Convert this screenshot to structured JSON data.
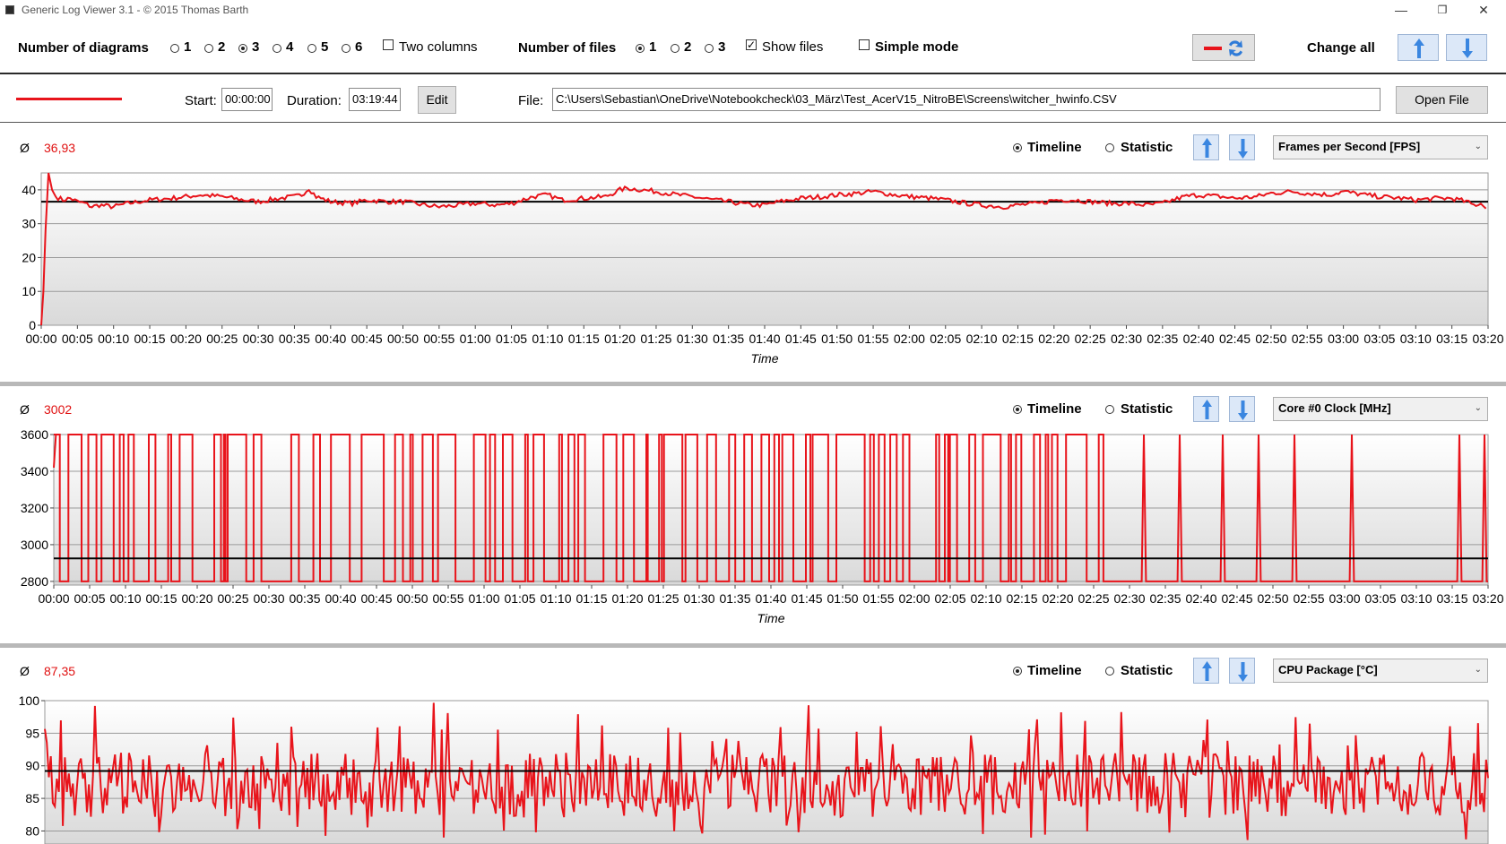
{
  "window": {
    "title": "Generic Log Viewer 3.1 - © 2015 Thomas Barth",
    "minimize": "—",
    "restore": "❐",
    "close": "✕"
  },
  "toolbar": {
    "num_diagrams_label": "Number of diagrams",
    "diagram_options": [
      "1",
      "2",
      "3",
      "4",
      "5",
      "6"
    ],
    "diagram_selected": "3",
    "two_columns_label": "Two columns",
    "num_files_label": "Number of files",
    "file_options": [
      "1",
      "2",
      "3"
    ],
    "file_selected": "1",
    "show_files_label": "Show files",
    "show_files_checked": true,
    "simple_mode_label": "Simple mode",
    "simple_mode_checked": false,
    "change_all_label": "Change all",
    "swap_button_icon": "swap-color-icon",
    "arrow_up_icon": "arrow-up-icon",
    "arrow_down_icon": "arrow-down-icon"
  },
  "file_row": {
    "series_color": "#e8141b",
    "start_label": "Start:",
    "start_value": "00:00:00",
    "duration_label": "Duration:",
    "duration_value": "03:19:44",
    "edit_label": "Edit",
    "file_label": "File:",
    "file_path": "C:\\Users\\Sebastian\\OneDrive\\Notebookcheck\\03_März\\Test_AcerV15_NitroBE\\Screens\\witcher_hwinfo.CSV",
    "open_file_label": "Open File"
  },
  "panels": [
    {
      "avg_symbol": "Ø",
      "avg_value": "36,93",
      "timeline_label": "Timeline",
      "statistic_label": "Statistic",
      "mode": "Timeline",
      "sensor": "Frames per Second [FPS]"
    },
    {
      "avg_symbol": "Ø",
      "avg_value": "3002",
      "timeline_label": "Timeline",
      "statistic_label": "Statistic",
      "mode": "Timeline",
      "sensor": "Core #0 Clock [MHz]"
    },
    {
      "avg_symbol": "Ø",
      "avg_value": "87,35",
      "timeline_label": "Timeline",
      "statistic_label": "Statistic",
      "mode": "Timeline",
      "sensor": "CPU Package [°C]"
    }
  ],
  "chart_data": [
    {
      "type": "line",
      "xlabel": "Time",
      "ylabel": "",
      "ylim": [
        0,
        45
      ],
      "yticks": [
        0,
        10,
        20,
        30,
        40
      ],
      "x_ticks": [
        "00:00",
        "00:05",
        "00:10",
        "00:15",
        "00:20",
        "00:25",
        "00:30",
        "00:35",
        "00:40",
        "00:45",
        "00:50",
        "00:55",
        "01:00",
        "01:05",
        "01:10",
        "01:15",
        "01:20",
        "01:25",
        "01:30",
        "01:35",
        "01:40",
        "01:45",
        "01:50",
        "01:55",
        "02:00",
        "02:05",
        "02:10",
        "02:15",
        "02:20",
        "02:25",
        "02:30",
        "02:35",
        "02:40",
        "02:45",
        "02:50",
        "02:55",
        "03:00",
        "03:05",
        "03:10",
        "03:15",
        "03:20"
      ],
      "xlim_minutes": [
        0,
        200
      ],
      "average_line": 36.5,
      "grid": "horizontal",
      "series": [
        {
          "color": "#e8141b",
          "x_minutes": [
            0,
            0.3,
            0.6,
            1,
            1.5,
            2,
            3,
            4,
            5,
            6,
            7,
            8,
            10,
            12,
            15,
            18,
            20,
            22,
            25,
            28,
            30,
            33,
            35,
            36,
            37,
            38,
            40,
            43,
            45,
            48,
            50,
            53,
            55,
            58,
            60,
            63,
            65,
            68,
            70,
            72,
            75,
            78,
            80,
            81,
            83,
            85,
            88,
            90,
            93,
            95,
            98,
            100,
            102,
            105,
            108,
            110,
            113,
            115,
            118,
            120,
            123,
            125,
            128,
            130,
            133,
            135,
            138,
            140,
            143,
            145,
            148,
            150,
            153,
            155,
            158,
            160,
            163,
            165,
            168,
            170,
            173,
            175,
            178,
            180,
            183,
            185,
            188,
            190,
            193,
            195,
            197,
            198,
            199,
            199.7
          ],
          "values": [
            0,
            10,
            28,
            45,
            40,
            38,
            37,
            37.5,
            36.5,
            36,
            35,
            35.5,
            35,
            36,
            37,
            37.5,
            38,
            38.5,
            38,
            37,
            36.5,
            37.5,
            38,
            38.5,
            40.5,
            38,
            36.5,
            36,
            37,
            36.5,
            36.5,
            35.5,
            35,
            35.5,
            36,
            35.5,
            36,
            38,
            38.5,
            37,
            37.5,
            38,
            40,
            40.5,
            40,
            39.5,
            38.5,
            38,
            37,
            36.5,
            35.5,
            35.5,
            36.5,
            37.5,
            38,
            38.5,
            39,
            39.5,
            38.5,
            38,
            37.5,
            37,
            36,
            35.5,
            35,
            35.5,
            36,
            37,
            37,
            36.5,
            36,
            36,
            35.5,
            36,
            38,
            38.5,
            38,
            37.5,
            38,
            39,
            39.5,
            39,
            38.5,
            39.5,
            38.5,
            38,
            37.5,
            37,
            37.5,
            37.5,
            36.5,
            35.5,
            36,
            34.5
          ]
        }
      ]
    },
    {
      "type": "line",
      "xlabel": "Time",
      "ylabel": "",
      "ylim": [
        2780,
        3600
      ],
      "yticks": [
        2800,
        3000,
        3200,
        3400,
        3600
      ],
      "x_ticks": [
        "00:00",
        "00:05",
        "00:10",
        "00:15",
        "00:20",
        "00:25",
        "00:30",
        "00:35",
        "00:40",
        "00:45",
        "00:50",
        "00:55",
        "01:00",
        "01:05",
        "01:10",
        "01:15",
        "01:20",
        "01:25",
        "01:30",
        "01:35",
        "01:40",
        "01:45",
        "01:50",
        "01:55",
        "02:00",
        "02:05",
        "02:10",
        "02:15",
        "02:20",
        "02:25",
        "02:30",
        "02:35",
        "02:40",
        "02:45",
        "02:50",
        "02:55",
        "03:00",
        "03:05",
        "03:10",
        "03:15",
        "03:20"
      ],
      "xlim_minutes": [
        0,
        200
      ],
      "average_line": 2925,
      "grid": "horizontal",
      "series": [
        {
          "color": "#e8141b",
          "low": 2800,
          "high": 3600,
          "dense_until_minutes": 150,
          "sparse_spikes_minutes": [
            152,
            157,
            163,
            168,
            173,
            181,
            196,
            199.5
          ]
        }
      ]
    },
    {
      "type": "line",
      "xlabel": "",
      "ylabel": "",
      "ylim": [
        78,
        100
      ],
      "yticks": [
        80,
        85,
        90,
        95,
        100
      ],
      "xlim_minutes": [
        0,
        200
      ],
      "average_line": 89.2,
      "grid": "horizontal",
      "series": [
        {
          "color": "#e8141b",
          "range": [
            80,
            100
          ],
          "center": 87,
          "samples": 720
        }
      ]
    }
  ]
}
